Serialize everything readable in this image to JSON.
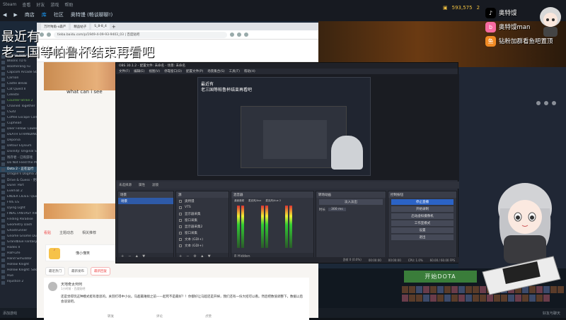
{
  "overlay": {
    "title_line1": "最近有",
    "title_line2": "老三国等帕鲁杯结束再看吧",
    "social": [
      {
        "icon": "tiktok-icon",
        "text": "奥特馒"
      },
      {
        "icon": "bilibili-icon",
        "text": "奥特馒man"
      },
      {
        "icon": "douyu-icon",
        "text": "钻粉加群看鱼吧置顶"
      }
    ]
  },
  "steam": {
    "title_menu": [
      "Steam",
      "查看",
      "好友",
      "游戏",
      "帮助"
    ],
    "nav": [
      "商店",
      "库",
      "社区",
      "奥特馒 (畅谈聊聊!)"
    ],
    "nav_active": 1,
    "currency": [
      "593,575",
      "2"
    ],
    "library": [
      "Bloody Halloween",
      "Bloons TD 6",
      "Boomerang Fu",
      "Capcom Arcade Stadium",
      "Carrion",
      "Castle Break",
      "Cat Quest II",
      "Celeste",
      "Counter-Strike 2",
      "Chained Together",
      "CS2D",
      "Coffee Escape Collection",
      "Cuphead",
      "Deer Fellow: Lawless",
      "DEATH STRANDING",
      "Deponia",
      "Detour Elysium",
      "Divinity: Original Sin 2",
      "残存者 - 已购游戏",
      "Do Not Feed the Monkeys",
      "Dota 2 - 正在运行",
      "Dragon's Dogma 2",
      "Drive & Guess - 更新队列",
      "Dune: Part",
      "EverFall 2",
      "ENDER LILIES: Quietus",
      "FIVE ES",
      "Dying Light",
      "FINAL FANTASY XIII",
      "Finding Paradise",
      "Geometry Dash",
      "Ghostrunner",
      "Gnome Gnome Dungeon",
      "Grandblue Fantasy",
      "Hades II",
      "Half-Life",
      "Hand Simulator",
      "Hollow Knight",
      "Hollow Knight: Silksong",
      "Hue",
      "Injustice 2"
    ],
    "library_highlight": 20,
    "play_button": "开始DOTA",
    "bottom_left": "添加游戏",
    "bottom_right": "好友与聊天"
  },
  "browser": {
    "tabs": [
      "万叶殉角-x森严",
      "精品帖子",
      "S_8-8_4"
    ],
    "url": "tieba.baidu.com/p/1949-4-09-93-9403_03 | 百度贴吧",
    "stats": [
      {
        "num": "9",
        "label": "全部帖子"
      },
      {
        "num": "12",
        "label": "精品贴"
      },
      {
        "num": "",
        "label": "图片"
      },
      {
        "num": "",
        "label": "视频"
      },
      {
        "num": "",
        "label": "投票"
      }
    ],
    "forum_greeting": "what can i see",
    "post_tabs": [
      "看贴",
      "主题动态",
      "相关推荐"
    ],
    "post_tab_active": 0,
    "sign_card_text": "懂小懂笑",
    "sort_tabs": [
      "最近热门",
      "最新发布",
      "最新回复"
    ],
    "sort_tab_active": 2,
    "post": {
      "author": "天地奇太何何",
      "meta": "1小时前 · 百度贴吧",
      "text": "还是觉得玩这种模式挺有意思的。关羽打得中小伙。马超最难搞之前——起死不是最好？！你都好让马超还是开掉，我们还有一份大招可以看。然后把数值调整下，数据以后会谈谈吧。",
      "actions": [
        "转发",
        "评论",
        "点赞"
      ]
    }
  },
  "obs": {
    "title": "OBS 30.1.2 - 配置文件: 未命名 - 场景: 未命名",
    "menu": [
      "文件(F)",
      "编辑(E)",
      "视图(V)",
      "停靠窗口(D)",
      "配置文件(P)",
      "场景集合(S)",
      "工具(T)",
      "帮助(H)"
    ],
    "status_bar": [
      "未选择源",
      "属性",
      "滤镜"
    ],
    "docks": {
      "scenes": {
        "title": "场景",
        "items": [
          "场景"
        ]
      },
      "sources": {
        "title": "源",
        "items": [
          "奥特馒",
          "VTS",
          "显示器采集",
          "窗口采集",
          "显示器采集2",
          "窗口采集",
          "文本 (GDI+)",
          "文本 (GDI+)"
        ]
      },
      "mixer": {
        "title": "混音器",
        "channels": [
          "桌面音频",
          "麦克风/Aux",
          "麦克风/Aux 2"
        ],
        "foot": "8 Hidden"
      },
      "transitions": {
        "title": "转场动画",
        "type": "淡入淡出",
        "duration_label": "时长",
        "duration": "300 ms"
      },
      "controls": {
        "title": "控制按钮",
        "buttons": [
          "停止直播",
          "开始录制",
          "启动虚拟摄像机",
          "工作室模式",
          "设置",
          "退出"
        ]
      }
    },
    "bottom_status": [
      "丢帧 0 (0.0%)",
      "00:00:00",
      "00:00:00",
      "CPU: 1.0%",
      "60.00 / 60.00 FPS"
    ]
  },
  "colors": {
    "steam_bg": "#1b2838",
    "obs_bg": "#2b2e38",
    "obs_accent": "#2b63c6",
    "play_green": "#3a7d3a"
  }
}
